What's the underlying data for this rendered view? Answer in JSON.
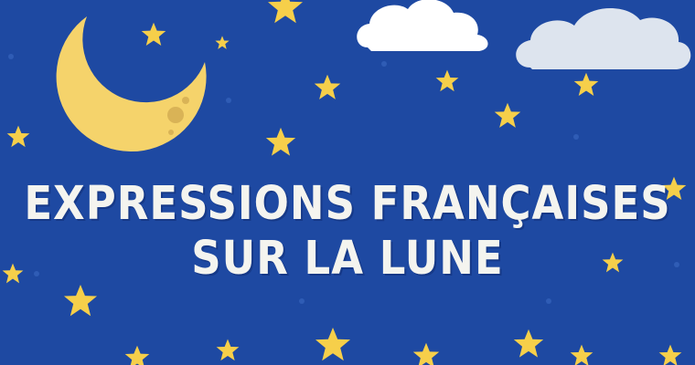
{
  "title": {
    "line1": "EXPRESSIONS FRANÇAISES",
    "line2": "SUR LA LUNE"
  },
  "colors": {
    "background": "#1e49a2",
    "moon": "#f5d36b",
    "moon_craters": "#d9b356",
    "stars": "#f6cf4a",
    "clouds": "#ffffff",
    "cloud_shade": "#dde4ee",
    "title_text": "#f4f4ef"
  },
  "icons": [
    "crescent-moon-icon",
    "star-icon",
    "cloud-icon"
  ]
}
